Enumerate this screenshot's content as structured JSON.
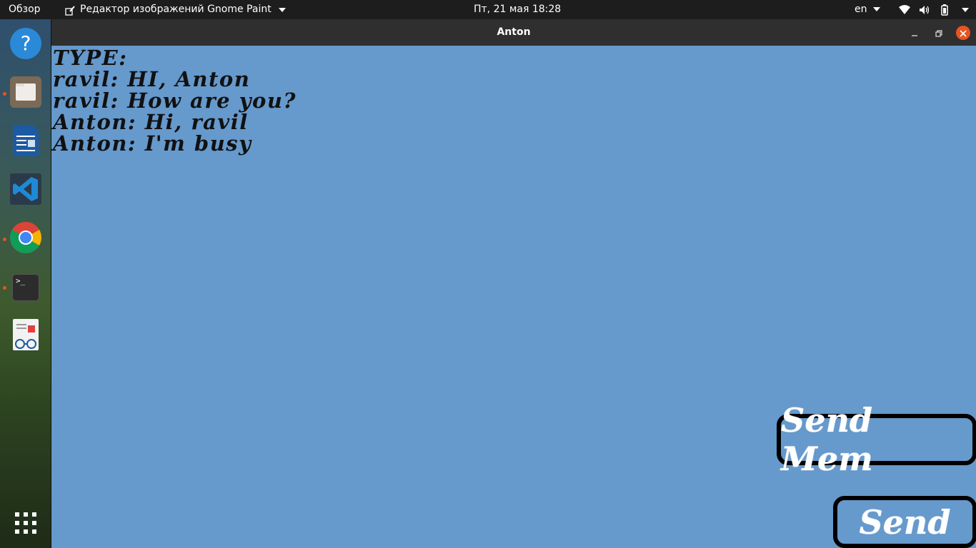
{
  "topbar": {
    "overview": "Обзор",
    "app_menu": "Редактор изображений Gnome Paint",
    "clock": "Пт, 21 мая  18:28",
    "lang": "en"
  },
  "dock": {
    "items": [
      {
        "name": "help",
        "icon": "help-icon"
      },
      {
        "name": "files",
        "icon": "folder-icon"
      },
      {
        "name": "libreoffice-writer",
        "icon": "document-icon"
      },
      {
        "name": "vscode",
        "icon": "vscode-icon"
      },
      {
        "name": "chrome",
        "icon": "chrome-icon"
      },
      {
        "name": "terminal",
        "icon": "terminal-icon",
        "label": ">_"
      },
      {
        "name": "document-viewer",
        "icon": "reader-icon"
      },
      {
        "name": "show-apps",
        "icon": "grid-icon"
      }
    ]
  },
  "window": {
    "title": "Anton",
    "chat": {
      "lines": [
        "TYPE:",
        "ravil: HI, Anton",
        "ravil: How are you?",
        "Anton: Hi, ravil",
        "Anton: I'm busy"
      ]
    },
    "buttons": {
      "send_mem": "Send Mem",
      "send": "Send"
    }
  },
  "colors": {
    "background": "#6699cc",
    "accent": "#e95420",
    "titlebar": "#2f2f2f"
  }
}
